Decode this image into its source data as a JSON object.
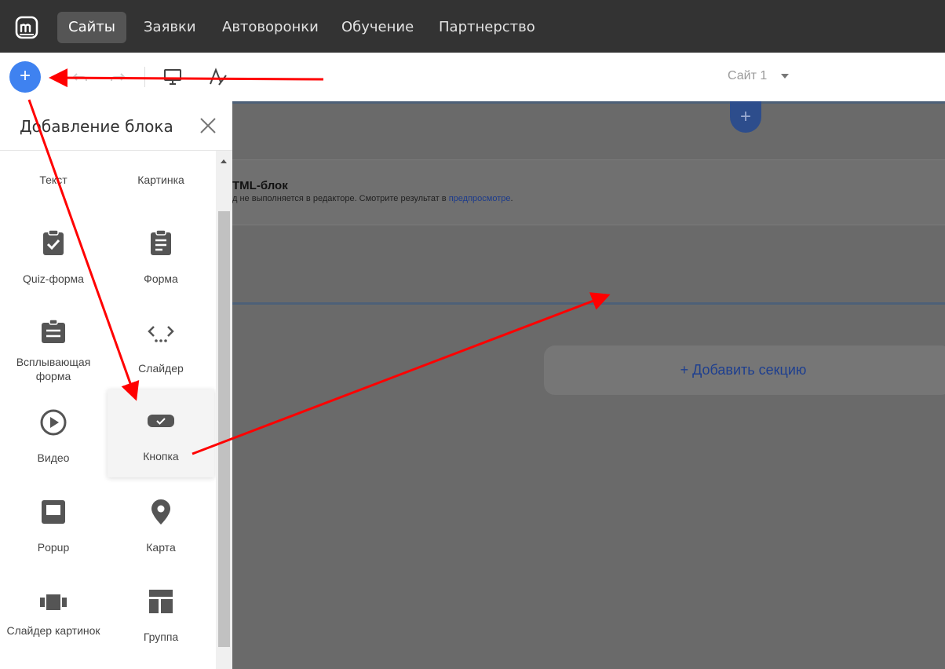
{
  "nav": {
    "items": [
      {
        "label": "Сайты",
        "active": true
      },
      {
        "label": "Заявки"
      },
      {
        "label": "Автоворонки"
      },
      {
        "label": "Обучение"
      },
      {
        "label": "Партнерство"
      }
    ]
  },
  "toolbar": {
    "add_label": "+",
    "site_select": "Сайт 1"
  },
  "panel": {
    "title": "Добавление блока",
    "tiles": [
      {
        "label": "Текст",
        "icon": "text-icon"
      },
      {
        "label": "Картинка",
        "icon": "image-icon"
      },
      {
        "label": "Quiz-форма",
        "icon": "quiz-form-icon"
      },
      {
        "label": "Форма",
        "icon": "form-icon"
      },
      {
        "label": "Всплывающая форма",
        "icon": "popup-form-icon"
      },
      {
        "label": "Слайдер",
        "icon": "slider-icon"
      },
      {
        "label": "Видео",
        "icon": "video-icon"
      },
      {
        "label": "Кнопка",
        "icon": "button-icon"
      },
      {
        "label": "Popup",
        "icon": "popup-icon"
      },
      {
        "label": "Карта",
        "icon": "map-pin-icon"
      },
      {
        "label": "Слайдер картинок",
        "icon": "image-slider-icon"
      },
      {
        "label": "Группа",
        "icon": "group-icon"
      }
    ]
  },
  "canvas": {
    "add_block_label": "+",
    "html_block_title": "TML-блок",
    "html_block_note": "д не выполняется в редакторе. Смотрите результат в ",
    "html_block_link": "предпросмотре",
    "html_block_note_end": ".",
    "add_section_label": "+ Добавить секцию"
  },
  "colors": {
    "topnav": "#333333",
    "accent": "#3f82f0",
    "annotation": "#ff0000",
    "link": "#1d3c8c"
  }
}
